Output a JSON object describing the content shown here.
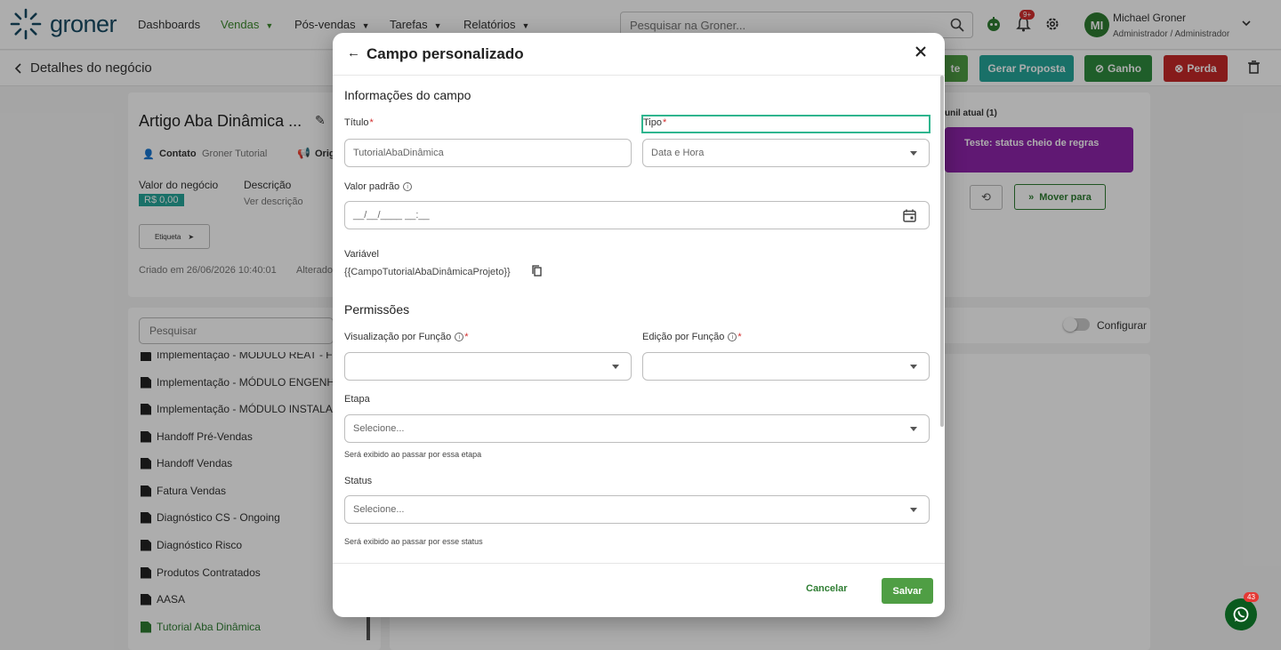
{
  "brand": {
    "name": "groner"
  },
  "nav": {
    "items": [
      {
        "label": "Dashboards"
      },
      {
        "label": "Vendas"
      },
      {
        "label": "Pós-vendas"
      },
      {
        "label": "Tarefas"
      },
      {
        "label": "Relatórios"
      }
    ]
  },
  "search": {
    "placeholder": "Pesquisar na Groner..."
  },
  "notifications": {
    "badge": "9+"
  },
  "user": {
    "initials": "MI",
    "name": "Michael Groner",
    "role": "Administrador / Administrador"
  },
  "subheader": {
    "back_label": "Detalhes do negócio",
    "buttons": {
      "partial_label": "te",
      "proposal": "Gerar Proposta",
      "won": "Ganho",
      "lost": "Perda"
    }
  },
  "deal": {
    "title": "Artigo Aba Dinâmica ...",
    "contact_label": "Contato",
    "contact_value": "Groner Tutorial",
    "origin_label": "Orig",
    "value_label": "Valor do negócio",
    "value": "R$ 0,00",
    "description_label": "Descrição",
    "description_value": "Ver descrição",
    "tag_label": "Etiqueta",
    "created": "Criado em 26/06/2026 10:40:01",
    "altered": "Alterado"
  },
  "funnel": {
    "title": "unil atual (1)",
    "stage_card": "Teste: status cheio de regras",
    "move_label": "Mover para"
  },
  "side_list": {
    "search_placeholder": "Pesquisar",
    "items": [
      {
        "label": "Implementação - MÓDULO REAT - FIN"
      },
      {
        "label": "Implementação - MÓDULO ENGENHAR"
      },
      {
        "label": "Implementação - MÓDULO INSTALAÇÃ"
      },
      {
        "label": "Handoff Pré-Vendas"
      },
      {
        "label": "Handoff Vendas"
      },
      {
        "label": "Fatura Vendas"
      },
      {
        "label": "Diagnóstico CS - Ongoing"
      },
      {
        "label": "Diagnóstico Risco"
      },
      {
        "label": "Produtos Contratados"
      },
      {
        "label": "AASA"
      },
      {
        "label": "Tutorial Aba Dinâmica"
      }
    ]
  },
  "configure_label": "Configurar",
  "modal": {
    "title": "Campo personalizado",
    "section_info": "Informações do campo",
    "title_label": "Título",
    "title_value": "TutorialAbaDinâmica",
    "type_label": "Tipo",
    "type_value": "Data e Hora",
    "default_label": "Valor padrão",
    "default_value": "__/__/____ __:__",
    "variable_label": "Variável",
    "variable_value": "{{CampoTutorialAbaDinâmicaProjeto}}",
    "section_permissions": "Permissões",
    "view_role_label": "Visualização por Função",
    "edit_role_label": "Edição por Função",
    "stage_label": "Etapa",
    "stage_placeholder": "Selecione...",
    "stage_helper": "Será exibido ao passar por essa etapa",
    "status_label": "Status",
    "status_placeholder": "Selecione...",
    "status_helper": "Será exibido ao passar por esse status",
    "cancel": "Cancelar",
    "save": "Salvar",
    "required_mark": "*",
    "info_mark": "i"
  },
  "whatsapp": {
    "badge": "43"
  },
  "colors": {
    "accent_green": "#2e7d32",
    "brand_blue": "#174a63",
    "danger": "#d32f2f",
    "teal": "#26a69a",
    "purple": "#8e24aa"
  }
}
